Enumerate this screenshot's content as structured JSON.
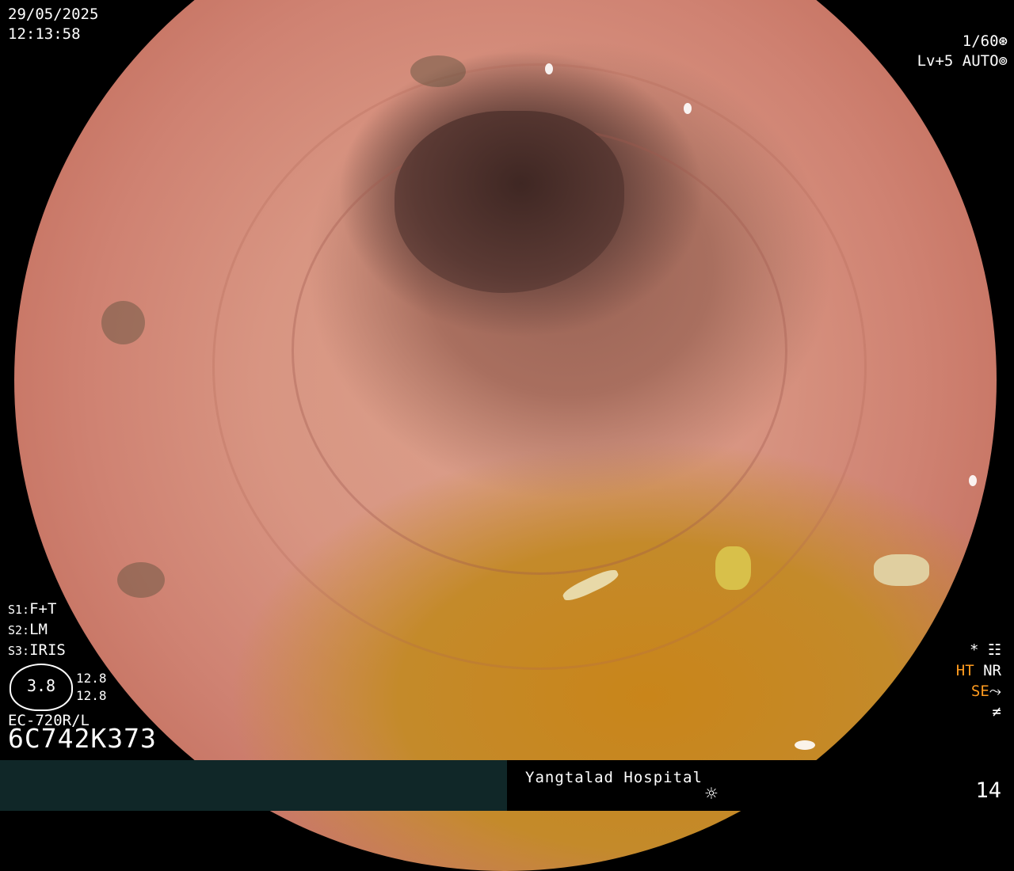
{
  "datetime": {
    "date": "29/05/2025",
    "time": "12:13:58"
  },
  "exposure": {
    "shutter": "1/60",
    "shutter_icon": "shutter-icon",
    "level": "Lv+5",
    "mode": "AUTO",
    "mode_icon": "iris-icon"
  },
  "settings": [
    {
      "key": "S1:",
      "value": "F+T"
    },
    {
      "key": "S2:",
      "value": "LM"
    },
    {
      "key": "S3:",
      "value": "IRIS"
    }
  ],
  "scope": {
    "dial_value": "3.8",
    "readings": [
      "12.8",
      "12.8"
    ],
    "model": "EC-720R/L",
    "serial": "6C742K373"
  },
  "status": {
    "star": "*",
    "ht": "HT",
    "nr": "NR",
    "se": "SE",
    "se_icon": "gamma-curve-icon",
    "noise_icon": "not-equal-icon"
  },
  "footer": {
    "hospital": "Yangtalad Hospital",
    "light_icon": "sun-icon",
    "image_number": "14"
  },
  "colors": {
    "text": "#ffffff",
    "accent": "#ff9b1f",
    "bar": "#102728"
  }
}
